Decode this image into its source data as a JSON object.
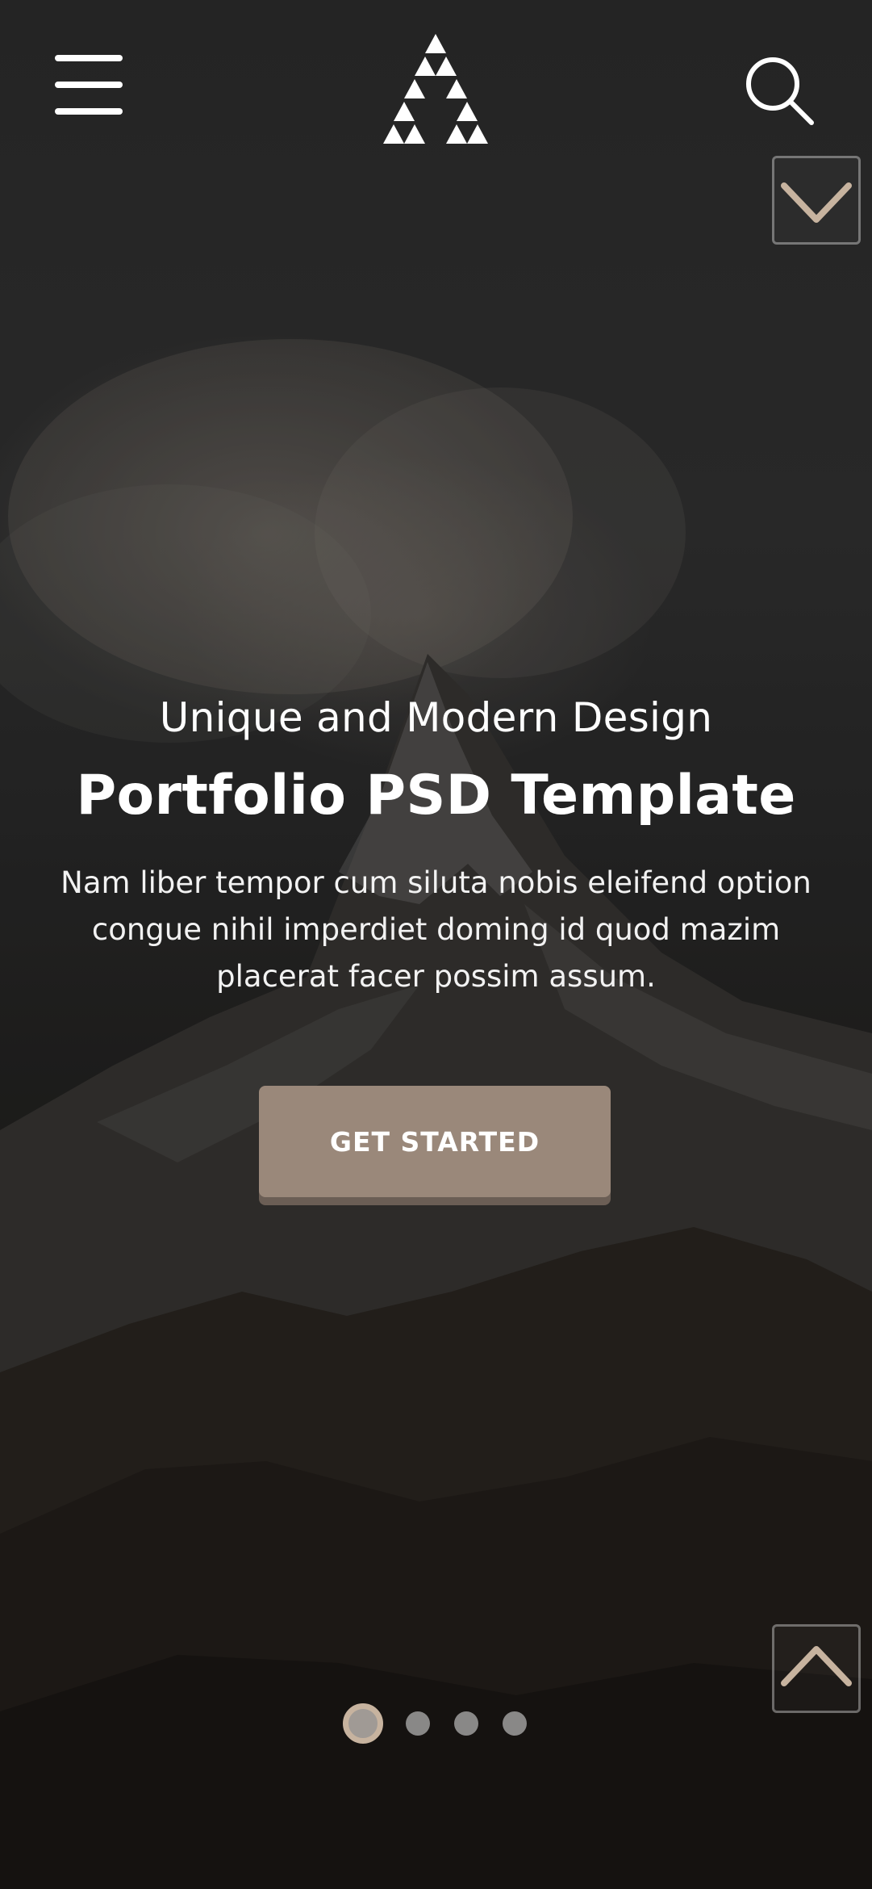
{
  "header": {
    "menu_icon": "hamburger-menu-icon",
    "logo_icon": "triangle-logo-icon",
    "search_icon": "search-icon"
  },
  "hero": {
    "subtitle": "Unique and Modern Design",
    "title": "Portfolio PSD Template",
    "description": "Nam liber tempor cum siluta nobis eleifend option congue nihil imperdiet doming id quod mazim placerat facer possim assum.",
    "cta_label": "GET STARTED"
  },
  "controls": {
    "scroll_down_icon": "chevron-down-icon",
    "scroll_up_icon": "chevron-up-icon"
  },
  "slider": {
    "total_slides": 4,
    "active_slide": 1
  },
  "colors": {
    "accent": "#c7b39f",
    "button": "#9a887a",
    "button_shadow": "#6b5e55",
    "text": "#ffffff"
  }
}
